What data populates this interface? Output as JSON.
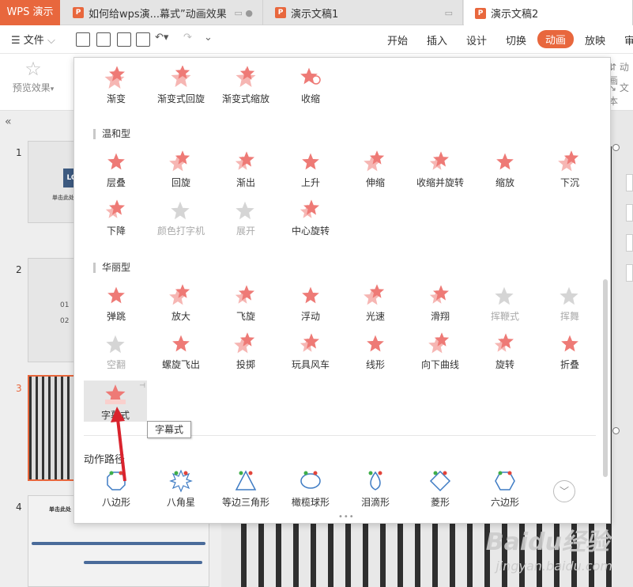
{
  "tabs": {
    "app": "WPS 演示",
    "doc1": "如何给wps演...幕式”动画效果",
    "doc2": "演示文稿1",
    "doc3": "演示文稿2"
  },
  "menu": {
    "file": "文件",
    "ribbon_tabs": [
      "开始",
      "插入",
      "设计",
      "切换",
      "动画",
      "放映",
      "审"
    ]
  },
  "ribbon": {
    "preview": "预览效果",
    "right_items": [
      "动画",
      "文本"
    ]
  },
  "accent": "#e8673d",
  "effects_panel": {
    "top_row": [
      {
        "label": "渐变"
      },
      {
        "label": "渐变式回旋"
      },
      {
        "label": "渐变式缩放"
      },
      {
        "label": "收缩"
      }
    ],
    "mild_title": "温和型",
    "mild": [
      {
        "label": "层叠"
      },
      {
        "label": "回旋"
      },
      {
        "label": "渐出"
      },
      {
        "label": "上升"
      },
      {
        "label": "伸缩"
      },
      {
        "label": "收缩并旋转"
      },
      {
        "label": "缩放"
      },
      {
        "label": "下沉"
      },
      {
        "label": "下降"
      },
      {
        "label": "颜色打字机",
        "disabled": true
      },
      {
        "label": "展开",
        "disabled": true
      },
      {
        "label": "中心旋转"
      }
    ],
    "fancy_title": "华丽型",
    "fancy": [
      {
        "label": "弹跳"
      },
      {
        "label": "放大"
      },
      {
        "label": "飞旋"
      },
      {
        "label": "浮动"
      },
      {
        "label": "光速"
      },
      {
        "label": "滑翔"
      },
      {
        "label": "挥鞭式",
        "disabled": true
      },
      {
        "label": "挥舞",
        "disabled": true
      },
      {
        "label": "空翻",
        "disabled": true
      },
      {
        "label": "螺旋飞出"
      },
      {
        "label": "投掷"
      },
      {
        "label": "玩具风车"
      },
      {
        "label": "线形"
      },
      {
        "label": "向下曲线"
      },
      {
        "label": "旋转"
      },
      {
        "label": "折叠"
      }
    ],
    "selected": {
      "label": "字幕式"
    },
    "tooltip": "字幕式",
    "path_title": "动作路径",
    "paths": [
      {
        "label": "八边形",
        "shape": "octagon"
      },
      {
        "label": "八角星",
        "shape": "star8"
      },
      {
        "label": "等边三角形",
        "shape": "triangle"
      },
      {
        "label": "橄榄球形",
        "shape": "ellipse"
      },
      {
        "label": "泪滴形",
        "shape": "teardrop"
      },
      {
        "label": "菱形",
        "shape": "diamond"
      },
      {
        "label": "六边形",
        "shape": "hexagon"
      }
    ]
  },
  "slides": {
    "numbers": [
      "1",
      "2",
      "3",
      "4"
    ],
    "slide1_title": "单击此处",
    "slide1_logo": "LO",
    "slide2_items": [
      "01",
      "02"
    ],
    "slide4_title": "单击此处"
  },
  "watermark": {
    "brand": "Baidu经验",
    "url": "jingyan.baidu.com"
  }
}
